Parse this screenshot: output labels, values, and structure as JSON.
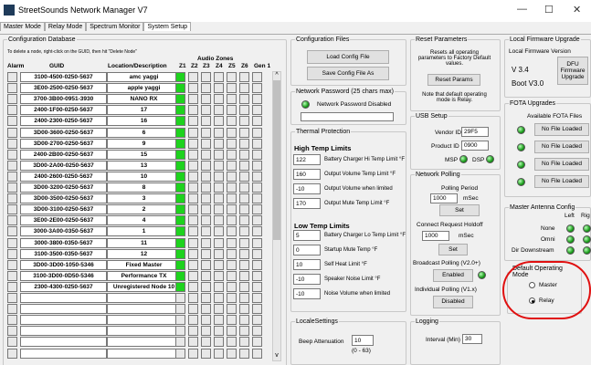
{
  "window": {
    "title": "StreetSounds Network Manager V7",
    "minimize": "—",
    "maximize": "☐",
    "close": "✕"
  },
  "tabs": [
    "Master Mode",
    "Relay Mode",
    "Spectrum Monitor",
    "System Setup"
  ],
  "config_db": {
    "legend": "Configuration Database",
    "hint": "To delete a node, right-click on the GUID, then hit \"Delete Node\"",
    "audio_zones": "Audio Zones",
    "headers": {
      "alarm": "Alarm",
      "guid": "GUID",
      "loc": "Location/Description",
      "z1": "Z1",
      "z2": "Z2",
      "z3": "Z3",
      "z4": "Z4",
      "z5": "Z5",
      "z6": "Z6",
      "gen1": "Gen 1"
    },
    "rows": [
      {
        "guid": "3100-4500-0250-5637",
        "loc": "amc yaggi"
      },
      {
        "guid": "3E00-2500-0250-5637",
        "loc": "apple yaggi"
      },
      {
        "guid": "3700-3B00-0951-3930",
        "loc": "NANO RX"
      },
      {
        "guid": "2400-1F00-0250-5637",
        "loc": "17"
      },
      {
        "guid": "2400-2300-0250-5637",
        "loc": "16"
      },
      {
        "guid": "3D00-3600-0250-5637",
        "loc": "6"
      },
      {
        "guid": "3D00-2700-0250-5637",
        "loc": "9"
      },
      {
        "guid": "2400-2B00-0250-5637",
        "loc": "15"
      },
      {
        "guid": "3D00-2A00-0250-5637",
        "loc": "13"
      },
      {
        "guid": "2400-2600-0250-5637",
        "loc": "10"
      },
      {
        "guid": "3D00-3200-0250-5637",
        "loc": "8"
      },
      {
        "guid": "3D00-3500-0250-5637",
        "loc": "3"
      },
      {
        "guid": "3D00-3100-0250-5637",
        "loc": "2"
      },
      {
        "guid": "3E00-2E00-0250-5637",
        "loc": "4"
      },
      {
        "guid": "3000-3A00-0350-5637",
        "loc": "1"
      },
      {
        "guid": "3000-3800-0350-5637",
        "loc": "11"
      },
      {
        "guid": "3100-3500-0350-5637",
        "loc": "12"
      },
      {
        "guid": "3D00-3D00-1050-5346",
        "loc": "Fixed Master"
      },
      {
        "guid": "3100-3D00-0D50-5346",
        "loc": "Performance TX"
      },
      {
        "guid": "2300-4300-0250-5637",
        "loc": "Unregistered Node 10"
      },
      {
        "guid": "",
        "loc": ""
      },
      {
        "guid": "",
        "loc": ""
      },
      {
        "guid": "",
        "loc": ""
      },
      {
        "guid": "",
        "loc": ""
      },
      {
        "guid": "",
        "loc": ""
      },
      {
        "guid": "",
        "loc": ""
      }
    ],
    "scroll_up": "^",
    "scroll_down": "v"
  },
  "config_files": {
    "legend": "Configuration Files",
    "load": "Load Config File",
    "save": "Save Config File As"
  },
  "network_password": {
    "legend": "Network Password (25 chars max)",
    "status": "Network Password Disabled",
    "value": ""
  },
  "thermal": {
    "legend": "Thermal Protection",
    "high_title": "High Temp Limits",
    "high": [
      {
        "value": "122",
        "label": "Battery Charger Hi Temp Limit °F"
      },
      {
        "value": "160",
        "label": "Output Volume Temp Limit °F"
      },
      {
        "value": "-10",
        "label": "Output Volume when limited"
      },
      {
        "value": "170",
        "label": "Output Mute Temp Limit °F"
      }
    ],
    "low_title": "Low Temp Limits",
    "low": [
      {
        "value": "5",
        "label": "Battery Charger Lo Temp Limit °F"
      },
      {
        "value": "0",
        "label": "Startup Mute Temp °F"
      },
      {
        "value": "10",
        "label": "Self Heat Limit °F"
      },
      {
        "value": "-10",
        "label": "Speaker Noise Limit °F"
      },
      {
        "value": "-10",
        "label": "Noise Volume when limited"
      }
    ]
  },
  "locale": {
    "legend": "LocaleSettings",
    "beep_label": "Beep Attenuation",
    "beep_value": "10",
    "beep_range": "(0 - 63)"
  },
  "reset": {
    "legend": "Reset Parameters",
    "desc": "Resets all operating parameters to Factory Default values.",
    "button": "Reset Params",
    "note": "Note that default operating mode is Relay."
  },
  "usb": {
    "legend": "USB Setup",
    "vendor_label": "Vendor ID",
    "vendor_value": "29F5",
    "product_label": "Product ID",
    "product_value": "0900",
    "msp": "MSP",
    "dsp": "DSP"
  },
  "polling": {
    "legend": "Network Polling",
    "period_label": "Polling Period",
    "period_value": "1000",
    "period_unit": "mSec",
    "set1": "Set",
    "holdoff_label": "Connect Request Holdoff",
    "holdoff_value": "1000",
    "holdoff_unit": "mSec",
    "set2": "Set",
    "broadcast_label": "Broadcast Polling (V2.0+)",
    "broadcast_btn": "Enabled",
    "individual_label": "Individual Polling (V1.x)",
    "individual_btn": "Disabled"
  },
  "logging": {
    "legend": "Logging",
    "interval_label": "Interval (Min)",
    "interval_value": "30"
  },
  "firmware": {
    "legend": "Local Firmware Upgrade",
    "version_label": "Local Firmware Version",
    "v1": "V 3.4",
    "v2": "Boot V3.0",
    "dfu": "DFU Firmware Upgrade"
  },
  "fota": {
    "legend": "FOTA Upgrades",
    "available": "Available FOTA Files",
    "files": [
      "No File Loaded",
      "No File Loaded",
      "No File Loaded",
      "No File Loaded"
    ]
  },
  "antenna": {
    "legend": "Master Antenna Config",
    "left": "Left",
    "right": "Rig",
    "rows": [
      "None",
      "Omni",
      "Dir Downstream"
    ]
  },
  "op_mode": {
    "legend": "Default Operating Mode",
    "master": "Master",
    "relay": "Relay",
    "selected": "Relay"
  },
  "colors": {
    "led_green": "#1ed21e",
    "annotation": "#e01010"
  }
}
